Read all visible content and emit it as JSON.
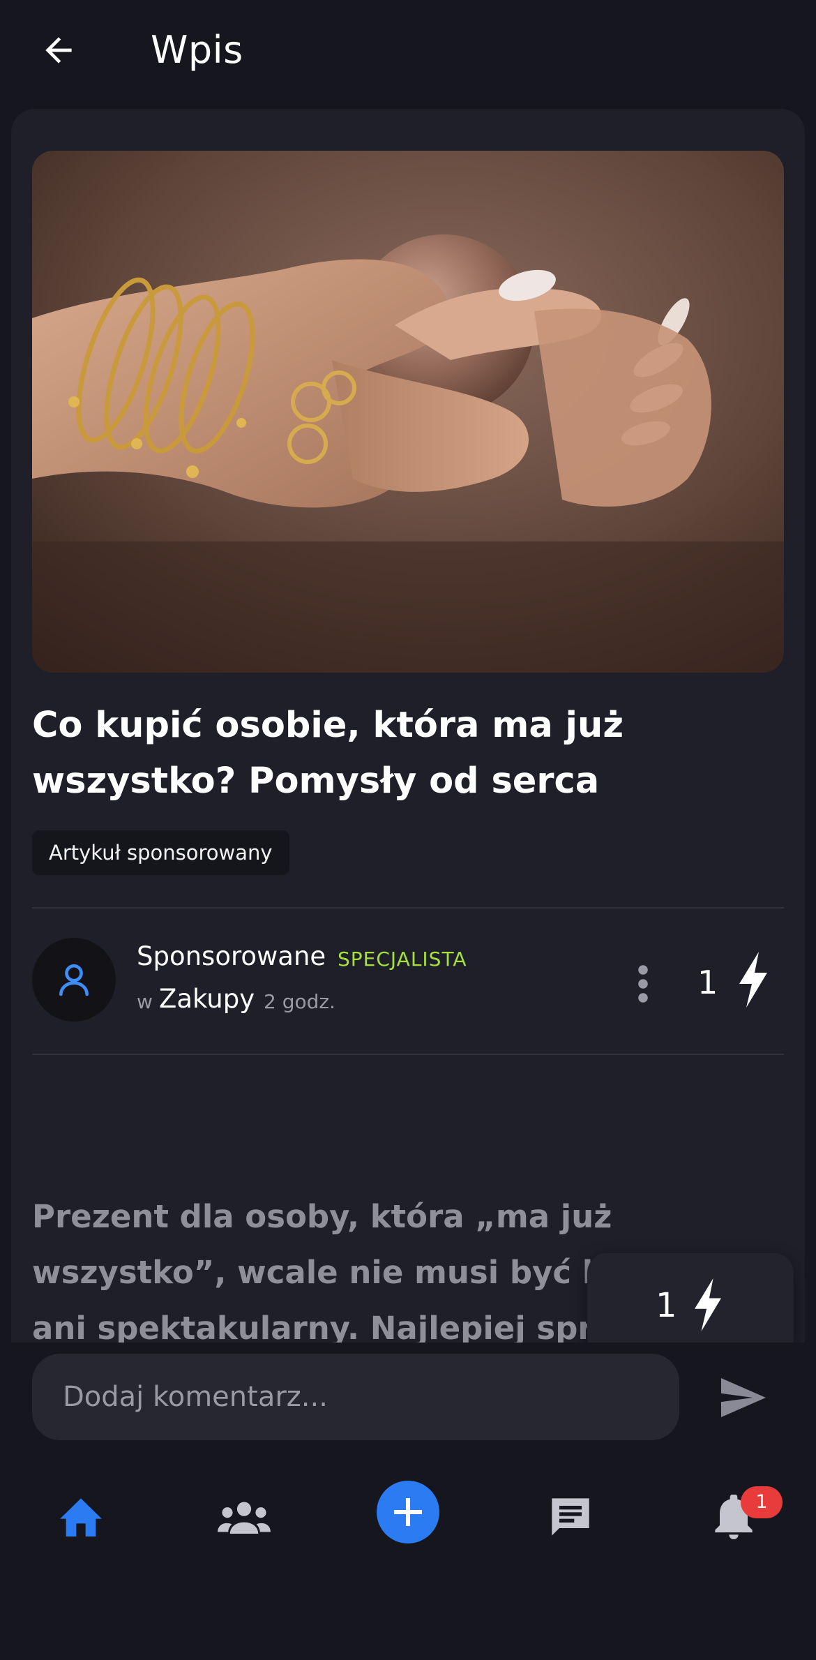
{
  "header": {
    "title": "Wpis"
  },
  "post": {
    "image_alt": "Dłonie z pierścionkami i złotymi bransoletkami trzymające szklaną kulę",
    "title": "Co kupić osobie, która ma już wszystko? Pomysły od serca",
    "tag": "Artykuł sponsorowany",
    "author": {
      "name": "Sponsorowane",
      "badge": "SPECJALISTA",
      "in_label": "w",
      "category": "Zakupy",
      "time": "2 godz."
    },
    "boost_count": "1",
    "body": "Prezent dla osoby, która „ma już wszystko”, wcale nie musi być kosztowny ani spektakularny. Najlepiej sprawdzają się upominki przemyślane, osobiste i dopasowane do relacji – takie, które"
  },
  "floating_boost": {
    "count": "1"
  },
  "composer": {
    "placeholder": "Dodaj komentarz..."
  },
  "bottom_nav": {
    "items": [
      "home-icon",
      "group-icon",
      "add-icon",
      "chat-icon",
      "bell-icon"
    ],
    "notifications_badge": "1"
  },
  "colors": {
    "background": "#16161e",
    "card": "#1f1f2a",
    "accent_blue": "#2b7bf3",
    "badge_green": "#a5e03c",
    "notification_red": "#e83c3c"
  }
}
